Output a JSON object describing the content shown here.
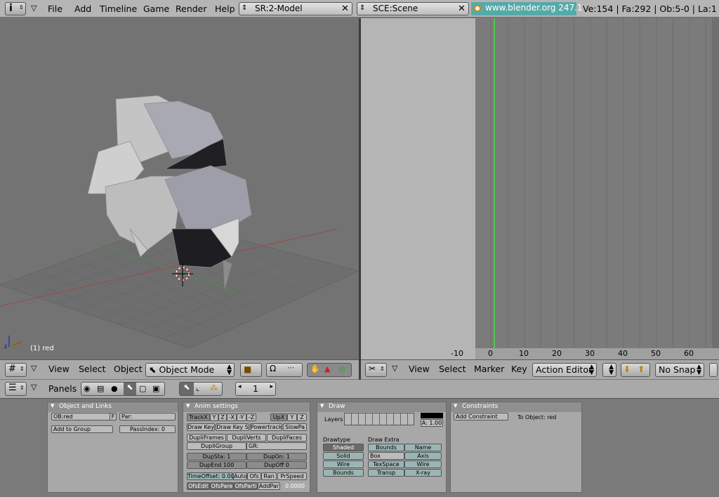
{
  "topbar": {
    "menus": [
      "File",
      "Add",
      "Timeline",
      "Game",
      "Render",
      "Help"
    ],
    "screen_field": "SR:2-Model",
    "scene_field": "SCE:Scene",
    "url": "www.blender.org 247.1",
    "stats": "Ve:154 | Fa:292 | Ob:5-0 | La:1"
  },
  "view3d": {
    "object_label": "(1) red",
    "header": {
      "menus": [
        "View",
        "Select",
        "Object"
      ],
      "mode": "Object Mode"
    }
  },
  "action_editor": {
    "frame_ticks": [
      "-10",
      "0",
      "10",
      "20",
      "30",
      "40",
      "50",
      "60"
    ],
    "header": {
      "menus": [
        "View",
        "Select",
        "Marker",
        "Key"
      ],
      "editor_type": "Action Editor",
      "snap": "No Snap"
    }
  },
  "buttons_window": {
    "header": {
      "panels_label": "Panels",
      "frame_value": "1"
    },
    "object_links": {
      "title": "Object and Links",
      "ob_field": "OB:red",
      "f_btn": "F",
      "par_field": "Par:",
      "add_group": "Add to Group",
      "pass_index": "PassIndex: 0"
    },
    "anim": {
      "title": "Anim settings",
      "track": [
        "TrackX",
        "Y",
        "Z",
        "-X",
        "-Y",
        "-Z"
      ],
      "up": [
        "UpX",
        "Y",
        "Z"
      ],
      "draw_key": "Draw Key",
      "draw_key_s": "Draw Key S",
      "powertrack": "Powertrack",
      "slowpar": "SlowPa",
      "dupliframes": "DupliFrames",
      "dupliverts": "DupliVerts",
      "duplifaces": "DupliFaces",
      "dupligroup": "DupliGroup",
      "gr": "GR:",
      "dupsta": "DupSta: 1",
      "dupon": "DupOn: 1",
      "dupend": "DupEnd 100",
      "dupoff": "DupOff 0",
      "timeoffset": "TimeOffset: 0.00",
      "auto": "Auto",
      "ofs": "Ofs",
      "ran": "Ran",
      "prspeed": "PrSpeed",
      "ofsedit": "OfsEdit",
      "ofspare": "OfsPare",
      "ofsparti": "OfsParti",
      "addpar": "AddPar",
      "value": "0.0000"
    },
    "draw": {
      "title": "Draw",
      "layers": "Layers",
      "alpha": "A: 1.00",
      "drawtype_label": "Drawtype",
      "drawtypes": [
        "Shaded",
        "Solid",
        "Wire",
        "Bounds"
      ],
      "extra_label": "Draw Extra",
      "bounds": "Bounds",
      "box": "Box",
      "texspace": "TexSpace",
      "transp": "Transp",
      "name": "Name",
      "axis": "Axis",
      "wire": "Wire",
      "xray": "X-ray"
    },
    "constraints": {
      "title": "Constraints",
      "add_constraint": "Add Constraint",
      "to_object": "To Object: red"
    }
  },
  "colors": {
    "url_bg": "#55aaa8",
    "frame_line": "#4ec84e",
    "viewport_bg": "#737373"
  }
}
